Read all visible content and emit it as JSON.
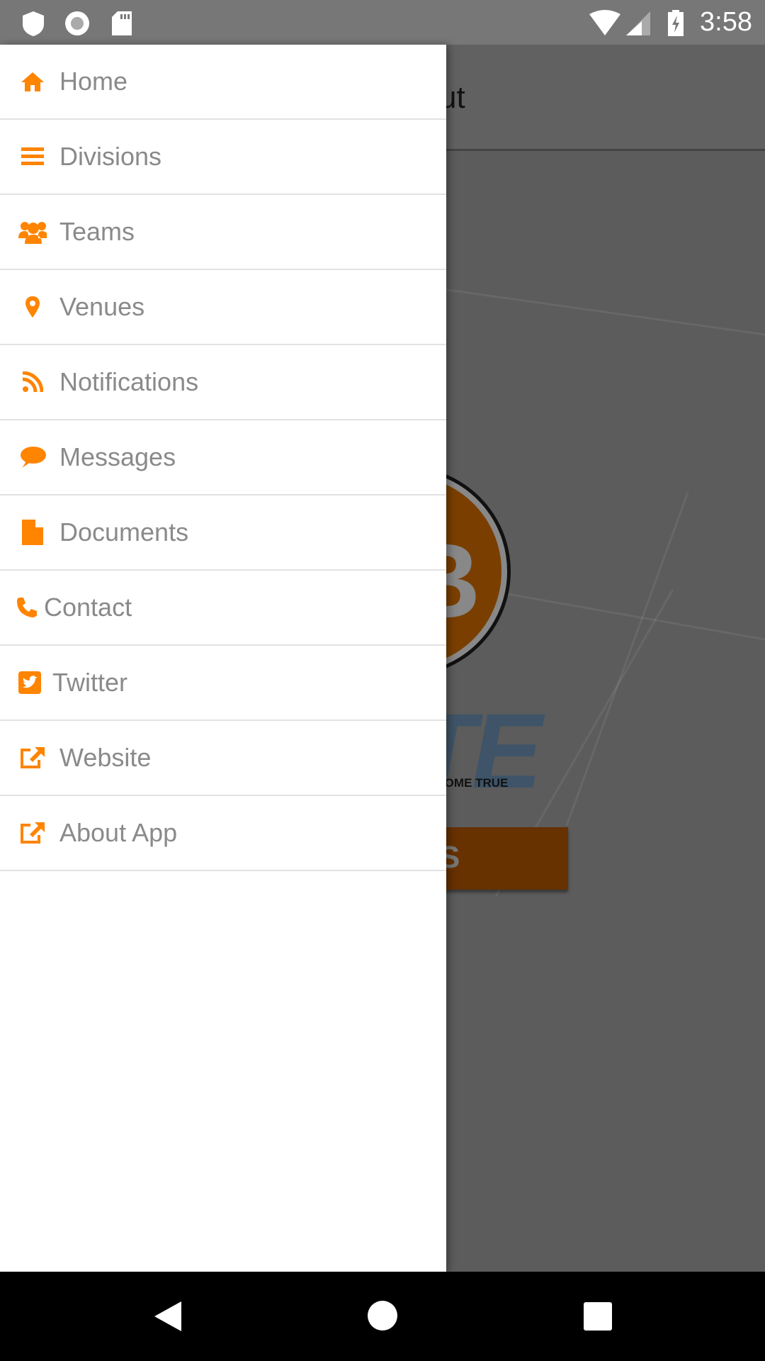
{
  "status_bar": {
    "time": "3:58",
    "icons": [
      "shield-icon",
      "circle-icon",
      "sd-card-icon",
      "wifi-icon",
      "signal-icon",
      "battery-charging-icon"
    ]
  },
  "background": {
    "header_title_fragment": "ut",
    "logo_tagline_fragment": "RT TO COME TRUE",
    "logo_text_fragment": "TE",
    "logo_letter": "B",
    "button_fragment": "S"
  },
  "accent_color": "#ff8400",
  "drawer": {
    "items": [
      {
        "label": "Home",
        "icon": "home-icon"
      },
      {
        "label": "Divisions",
        "icon": "list-icon"
      },
      {
        "label": "Teams",
        "icon": "users-icon"
      },
      {
        "label": "Venues",
        "icon": "map-marker-icon"
      },
      {
        "label": "Notifications",
        "icon": "rss-icon"
      },
      {
        "label": "Messages",
        "icon": "comment-icon"
      },
      {
        "label": "Documents",
        "icon": "file-icon"
      },
      {
        "label": "Contact",
        "icon": "phone-icon"
      },
      {
        "label": "Twitter",
        "icon": "twitter-square-icon"
      },
      {
        "label": "Website",
        "icon": "external-link-icon"
      },
      {
        "label": "About App",
        "icon": "external-link-icon"
      }
    ]
  },
  "nav_bar": {
    "buttons": [
      "back",
      "home",
      "recents"
    ]
  }
}
